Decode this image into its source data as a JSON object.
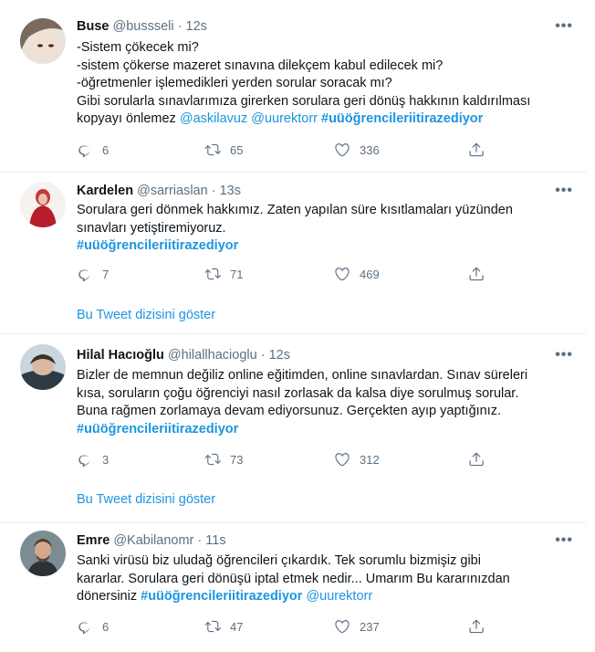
{
  "tweets": [
    {
      "name": "Buse",
      "handle": "@bussseli",
      "time": "12s",
      "more": "•••",
      "lines": [
        "-Sistem çökecek mi?",
        "-sistem çökerse mazeret sınavına dilekçem kabul edilecek mi?",
        "-öğretmenler işlemedikleri yerden sorular soracak mı?",
        "Gibi sorularla sınavlarımıza girerken sorulara geri dönüş hakkının kaldırılması"
      ],
      "last_line_prefix": "kopyayı önlemez ",
      "mention1": "@askilavuz",
      "mention2": "@uurektorr",
      "hashtag": "#uüöğrencileriitirazediyor",
      "replies": "6",
      "retweets": "65",
      "likes": "336"
    },
    {
      "name": "Kardelen",
      "handle": "@sarriaslan",
      "time": "13s",
      "more": "•••",
      "lines": [
        "Sorulara geri dönmek hakkımız. Zaten yapılan süre kısıtlamaları yüzünden",
        "sınavları yetiştiremiyoruz."
      ],
      "hashtag": "#uüöğrencileriitirazediyor",
      "replies": "7",
      "retweets": "71",
      "likes": "469",
      "thread": "Bu Tweet dizisini göster"
    },
    {
      "name": "Hilal Hacıoğlu",
      "handle": "@hilallhacioglu",
      "time": "12s",
      "more": "•••",
      "lines": [
        "Bizler de memnun değiliz online eğitimden, online sınavlardan. Sınav süreleri",
        "kısa, soruların çoğu öğrenciyi nasıl zorlasak da kalsa diye sorulmuş sorular.",
        "Buna rağmen zorlamaya devam ediyorsunuz. Gerçekten ayıp yaptığınız."
      ],
      "hashtag": "#uüöğrencileriitirazediyor",
      "replies": "3",
      "retweets": "73",
      "likes": "312",
      "thread": "Bu Tweet dizisini göster"
    },
    {
      "name": "Emre",
      "handle": "@Kabilanomr",
      "time": "11s",
      "more": "•••",
      "lines": [
        "Sanki virüsü biz uludağ öğrencileri çıkardık. Tek sorumlu bizmişiz gibi",
        "kararlar. Sorulara geri dönüşü iptal etmek nedir... Umarım  Bu kararınızdan"
      ],
      "last_line_prefix": "dönersiniz  ",
      "hashtag": "#uüöğrencileriitirazediyor",
      "mention1": "@uurektorr",
      "replies": "6",
      "retweets": "47",
      "likes": "237"
    }
  ],
  "separator": "·",
  "colors": {
    "link": "#1b95e0",
    "muted": "#5b7083",
    "border": "#e6ecf0"
  },
  "icons": [
    "reply-icon",
    "retweet-icon",
    "like-icon",
    "share-icon",
    "more-icon"
  ]
}
